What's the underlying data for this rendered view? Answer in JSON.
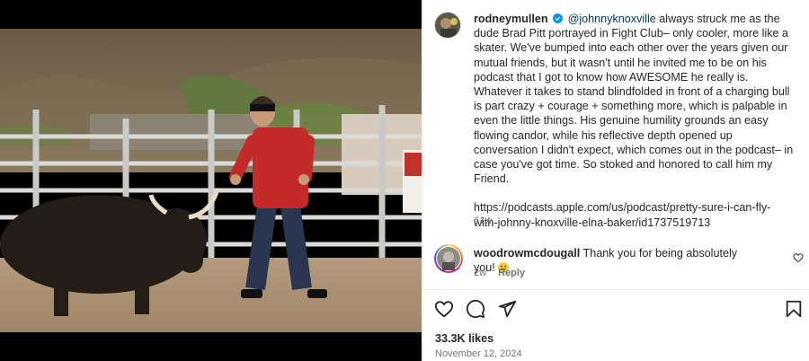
{
  "post": {
    "author": "rodneymullen",
    "mention": "@johnnyknoxville",
    "caption_text": "always struck me as the dude Brad Pitt portrayed in Fight Club– only cooler, more like a skater. We've bumped into each other over the years given our mutual friends, but it wasn't until he invited me to be on his podcast that I got to know how AWESOME he really is. Whatever it takes to stand blindfolded in front of a charging bull is part crazy + courage + something more, which is palpable in even the little things. His genuine humility grounds an easy flowing candor, while his reflective depth opened up conversation I didn't expect, which comes out in the podcast– in case you've got time. So stoked and honored to call him my Friend.",
    "link": "https://podcasts.apple.com/us/podcast/pretty-sure-i-can-fly-with-johnny-knoxville-elna-baker/id1737519713",
    "age": "61w",
    "likes": "33.3K likes",
    "date": "November 12, 2024"
  },
  "comment": {
    "author": "woodrowmcdougall",
    "text": "Thank you for being absolutely you!",
    "age": "2w",
    "reply_label": "Reply"
  },
  "colors": {
    "accent_blue": "#0095f6",
    "mention_blue": "#00376b",
    "muted": "#737373",
    "text": "#262626"
  },
  "icons": {
    "verified": "verified-badge-icon",
    "like": "heart-icon",
    "comment": "comment-bubble-icon",
    "share": "paper-plane-icon",
    "save": "bookmark-icon",
    "comment_like": "heart-small-icon",
    "emoji": "grinning-face-emoji"
  }
}
